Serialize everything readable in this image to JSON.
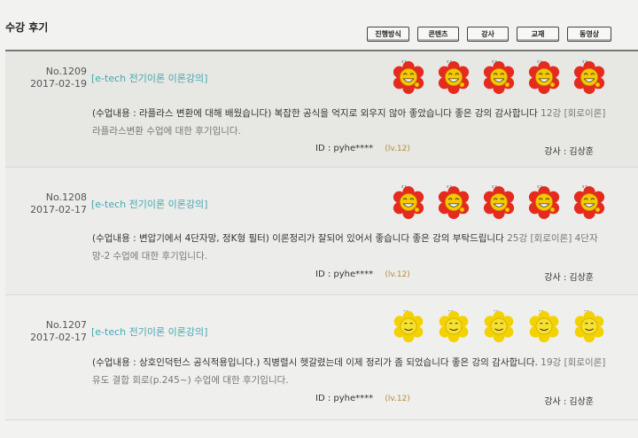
{
  "header": {
    "title": "수강 후기"
  },
  "tabs": [
    "진행방식",
    "콘텐츠",
    "강사",
    "교재",
    "동영상"
  ],
  "colors": {
    "accent": "#44a8b0",
    "face_red": "#e52a1e",
    "face_yellow": "#f3d200"
  },
  "reviews": [
    {
      "number": "No.1209",
      "date": "2017-02-19",
      "course": "[e-tech 전기이론 이론강의]",
      "rating_icons": [
        "laughing-face-icon",
        "laughing-face-icon",
        "laughing-face-icon",
        "laughing-face-icon",
        "laughing-face-icon"
      ],
      "text": "(수업내용 : 라플라스 변환에 대해 배웠습니다) 복잡한 공식을 억지로 외우지 않아 좋았습니다 좋은 강의 감사합니다",
      "quote": "12강 [회로이론] 라플라스변환 수업에 대한 후기입니다.",
      "user": "ID : pyhe****",
      "level": "(lv.12)",
      "teacher": "강사 : 김상훈"
    },
    {
      "number": "No.1208",
      "date": "2017-02-17",
      "course": "[e-tech 전기이론 이론강의]",
      "rating_icons": [
        "laughing-face-icon",
        "laughing-face-icon",
        "laughing-face-icon",
        "laughing-face-icon",
        "laughing-face-icon"
      ],
      "text": "(수업내용 : 변압기에서 4단자망, 정K형 필터) 이론정리가 잘되어 있어서 좋습니다 좋은 강의 부탁드립니다",
      "quote": "25강 [회로이론] 4단자망-2 수업에 대한 후기입니다.",
      "user": "ID : pyhe****",
      "level": "(lv.12)",
      "teacher": "강사 : 김상훈"
    },
    {
      "number": "No.1207",
      "date": "2017-02-17",
      "course": "[e-tech 전기이론 이론강의]",
      "rating_icons": [
        "smiling-face-icon",
        "smiling-face-icon",
        "smiling-face-icon",
        "smiling-face-icon",
        "smiling-face-icon"
      ],
      "text": "(수업내용 : 상호인덕턴스 공식적용입니다.) 직병렬시 헷갈렸는데 이제 정리가 좀 되었습니다 좋은 강의 감사합니다.",
      "quote": "19강 [회로이론] 유도 결합 회로(p.245~) 수업에 대한 후기입니다.",
      "user": "ID : pyhe****",
      "level": "(lv.12)",
      "teacher": "강사 : 김상훈"
    }
  ]
}
